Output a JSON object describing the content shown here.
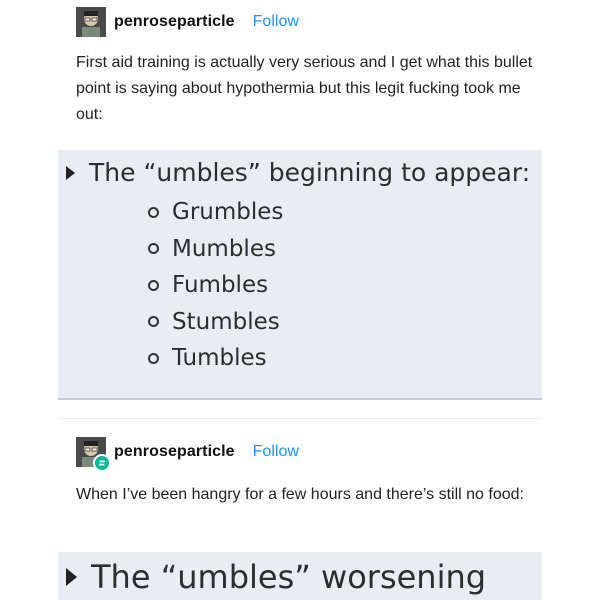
{
  "post1": {
    "username": "penroseparticle",
    "follow_label": "Follow",
    "text": "First aid training is actually very serious and I get what this bullet point is saying about hypothermia but this legit fucking took me out:",
    "slide": {
      "heading": "The “umbles” beginning to appear:",
      "items": [
        "Grumbles",
        "Mumbles",
        "Fumbles",
        "Stumbles",
        "Tumbles"
      ]
    }
  },
  "post2": {
    "username": "penroseparticle",
    "follow_label": "Follow",
    "text": "When I’ve been hangry for a few hours and there’s still no food:",
    "slide": {
      "heading": "The “umbles” worsening"
    },
    "reblog_badge_color": "#00b894"
  },
  "colors": {
    "follow": "#1e90ff",
    "slide_bg": "#e9edf3"
  }
}
